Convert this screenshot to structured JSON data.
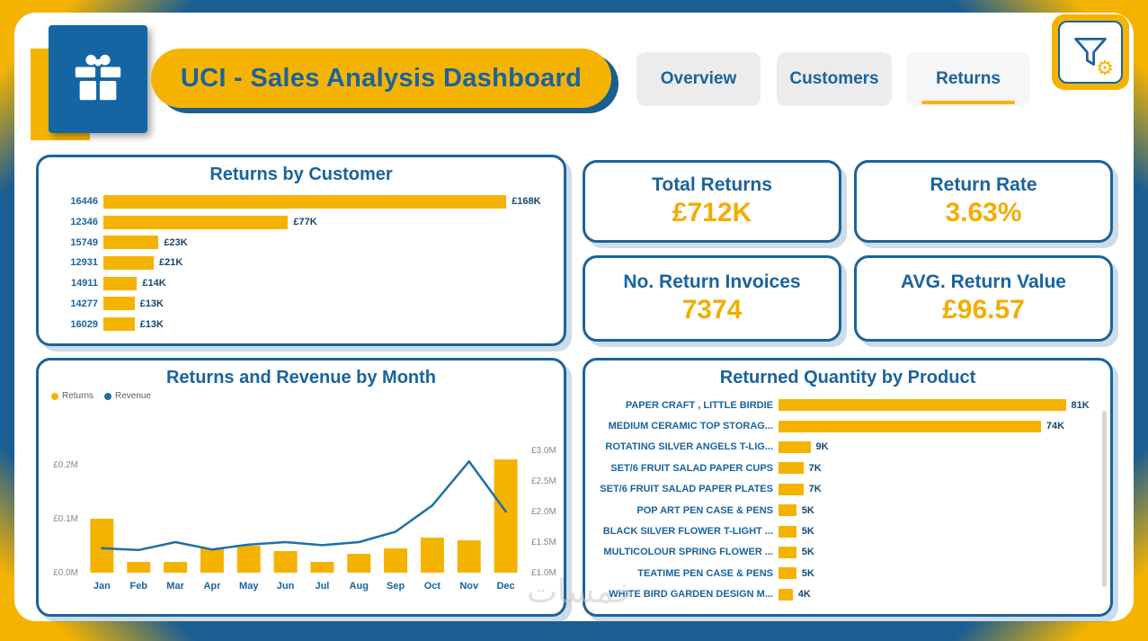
{
  "theme": {
    "blue": "#1A639E",
    "frame_blue": "#1B5E91",
    "gold": "#F5B301",
    "gold2": "#F2AD00",
    "navy": "#17476E",
    "line": "#1F6FA8",
    "tab_bg": "#ECECEC",
    "gray_text": "#8A8886"
  },
  "header": {
    "title": "UCI - Sales Analysis Dashboard",
    "tabs": [
      {
        "label": "Overview",
        "active": false
      },
      {
        "label": "Customers",
        "active": false
      },
      {
        "label": "Returns",
        "active": true
      }
    ]
  },
  "kpis": [
    {
      "title": "Total Returns",
      "value": "£712K"
    },
    {
      "title": "Return Rate",
      "value": "3.63%"
    },
    {
      "title": "No. Return Invoices",
      "value": "7374"
    },
    {
      "title": "AVG. Return Value",
      "value": "£96.57"
    }
  ],
  "chart_data": [
    {
      "type": "bar",
      "orientation": "horizontal",
      "title": "Returns by Customer",
      "categories": [
        "16446",
        "12346",
        "15749",
        "12931",
        "14911",
        "14277",
        "16029"
      ],
      "values": [
        168,
        77,
        23,
        21,
        14,
        13,
        13
      ],
      "value_labels": [
        "£168K",
        "£77K",
        "£23K",
        "£21K",
        "£14K",
        "£13K",
        "£13K"
      ],
      "unit": "GBP thousands",
      "bar_color": "#F5B301"
    },
    {
      "type": "combo",
      "title": "Returns and Revenue by Month",
      "categories": [
        "Jan",
        "Feb",
        "Mar",
        "Apr",
        "May",
        "Jun",
        "Jul",
        "Aug",
        "Sep",
        "Oct",
        "Nov",
        "Dec"
      ],
      "series": [
        {
          "name": "Returns",
          "type": "bar",
          "axis": "left",
          "values": [
            0.1,
            0.02,
            0.02,
            0.045,
            0.05,
            0.04,
            0.02,
            0.035,
            0.045,
            0.065,
            0.06,
            0.21
          ]
        },
        {
          "name": "Revenue",
          "type": "line",
          "axis": "right",
          "values": [
            1.4,
            1.37,
            1.5,
            1.38,
            1.46,
            1.5,
            1.45,
            1.5,
            1.67,
            2.1,
            2.82,
            2.0
          ]
        }
      ],
      "left_axis": {
        "unit": "£M",
        "ticks": [
          {
            "label": "£0.2M",
            "value": 0.2
          },
          {
            "label": "£0.1M",
            "value": 0.1
          },
          {
            "label": "£0.0M",
            "value": 0.0
          }
        ],
        "min": 0,
        "max": 0.22
      },
      "right_axis": {
        "unit": "£M",
        "ticks": [
          {
            "label": "£3.0M",
            "value": 3.0
          },
          {
            "label": "£2.5M",
            "value": 2.5
          },
          {
            "label": "£2.0M",
            "value": 2.0
          },
          {
            "label": "£1.5M",
            "value": 1.5
          },
          {
            "label": "£1.0M",
            "value": 1.0
          }
        ],
        "min": 1.0,
        "max": 3.0
      },
      "legend_position": "top-left",
      "grid": false
    },
    {
      "type": "bar",
      "orientation": "horizontal",
      "title": "Returned Quantity by Product",
      "categories": [
        "PAPER CRAFT , LITTLE BIRDIE",
        "MEDIUM CERAMIC TOP STORAG...",
        "ROTATING SILVER ANGELS T-LIG...",
        "SET/6 FRUIT SALAD PAPER CUPS",
        "SET/6 FRUIT SALAD PAPER PLATES",
        "POP ART PEN CASE & PENS",
        "BLACK SILVER FLOWER T-LIGHT ...",
        "MULTICOLOUR SPRING FLOWER ...",
        "TEATIME PEN CASE & PENS",
        "WHITE BIRD GARDEN DESIGN M..."
      ],
      "values": [
        81,
        74,
        9,
        7,
        7,
        5,
        5,
        5,
        5,
        4
      ],
      "value_labels": [
        "81K",
        "74K",
        "9K",
        "7K",
        "7K",
        "5K",
        "5K",
        "5K",
        "5K",
        "4K"
      ],
      "unit": "thousands of units",
      "bar_color": "#F5B301"
    }
  ],
  "watermark": "خمسات"
}
